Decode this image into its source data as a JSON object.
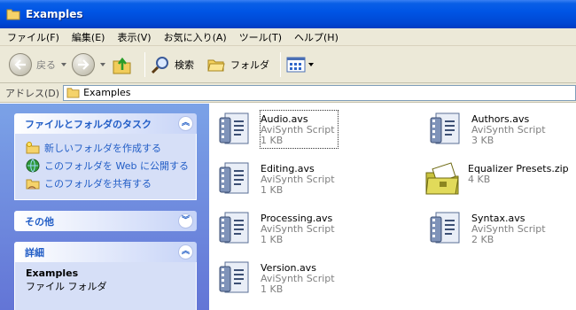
{
  "window": {
    "title": "Examples"
  },
  "menu": [
    "ファイル(F)",
    "編集(E)",
    "表示(V)",
    "お気に入り(A)",
    "ツール(T)",
    "ヘルプ(H)"
  ],
  "toolbar": {
    "back_label": "戻る",
    "search_label": "検索",
    "folders_label": "フォルダ"
  },
  "address": {
    "label": "アドレス(D)",
    "value": "Examples"
  },
  "tasks_panel": {
    "title": "ファイルとフォルダのタスク",
    "items": [
      "新しいフォルダを作成する",
      "このフォルダを Web に公開する",
      "このフォルダを共有する"
    ]
  },
  "other_panel": {
    "title": "その他"
  },
  "details_panel": {
    "title": "詳細",
    "name": "Examples",
    "type": "ファイル フォルダ"
  },
  "files": [
    {
      "name": "Audio.avs",
      "type": "AviSynth Script",
      "size": "1 KB",
      "icon": "avs-script-icon",
      "selected": true
    },
    {
      "name": "Authors.avs",
      "type": "AviSynth Script",
      "size": "3 KB",
      "icon": "avs-script-icon"
    },
    {
      "name": "Editing.avs",
      "type": "AviSynth Script",
      "size": "1 KB",
      "icon": "avs-script-icon"
    },
    {
      "name": "Equalizer Presets.zip",
      "type": "",
      "size": "4 KB",
      "icon": "zip-folder-icon"
    },
    {
      "name": "Processing.avs",
      "type": "AviSynth Script",
      "size": "1 KB",
      "icon": "avs-script-icon"
    },
    {
      "name": "Syntax.avs",
      "type": "AviSynth Script",
      "size": "2 KB",
      "icon": "avs-script-icon"
    },
    {
      "name": "Version.avs",
      "type": "AviSynth Script",
      "size": "1 KB",
      "icon": "avs-script-icon"
    }
  ],
  "colors": {
    "titlebar": "#0055e5",
    "link": "#215dc6",
    "chrome": "#ece9d8",
    "taskpane": "#6f8fdc"
  }
}
